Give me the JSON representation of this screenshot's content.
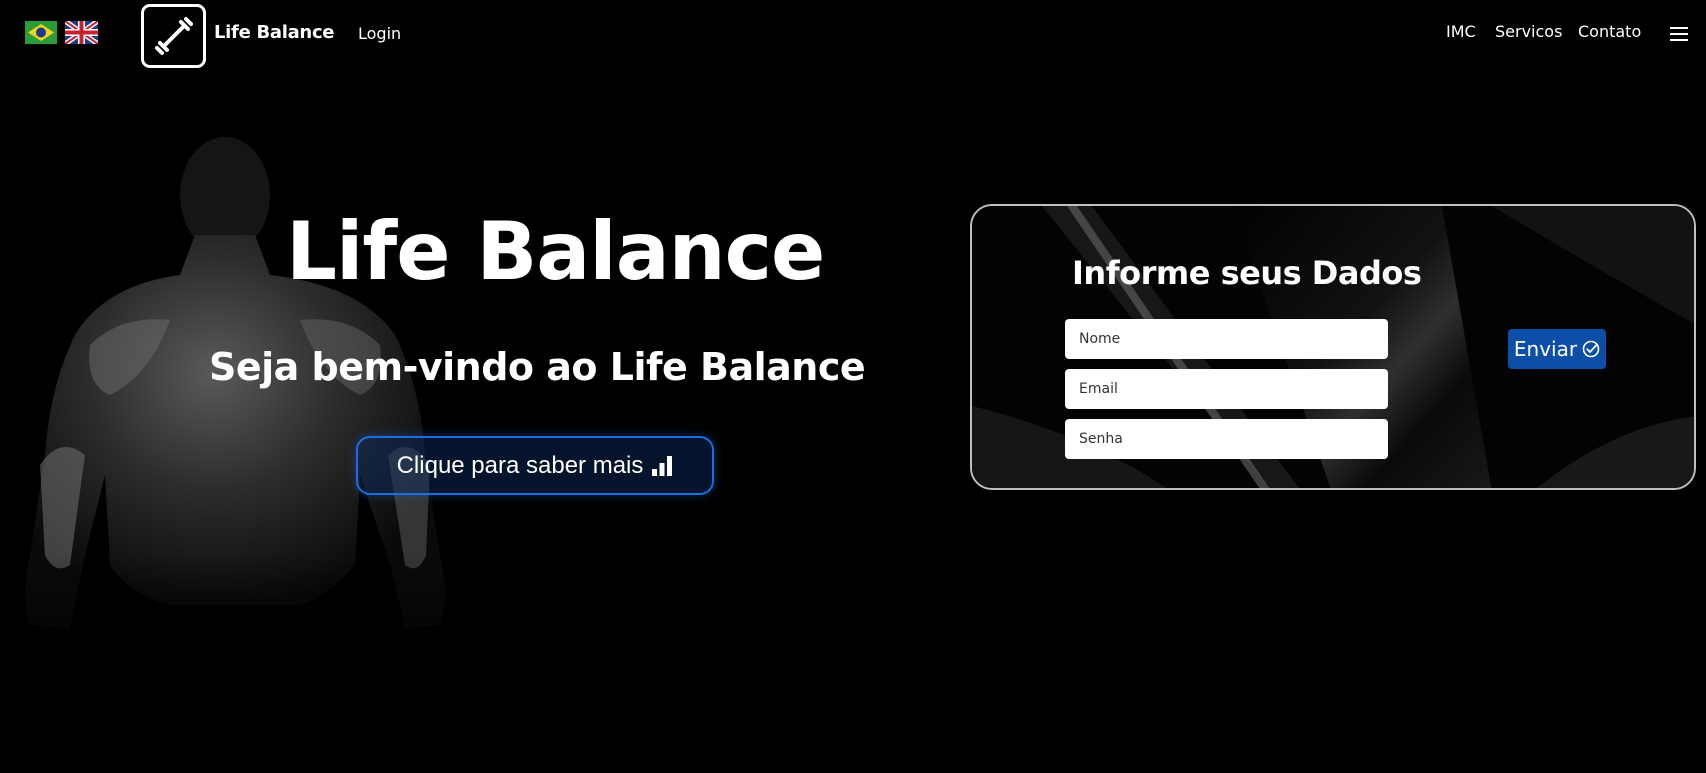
{
  "header": {
    "flags": [
      {
        "name": "brazil-flag-icon",
        "language": "pt-BR"
      },
      {
        "name": "uk-flag-icon",
        "language": "en"
      }
    ],
    "logo_icon": "dumbbell-icon",
    "brand": "Life Balance",
    "login_label": "Login",
    "nav": {
      "imc": "IMC",
      "servicos": "Servicos",
      "contato": "Contato"
    },
    "menu_icon": "hamburger-menu-icon"
  },
  "hero": {
    "title": "Life Balance",
    "subtitle": "Seja bem-vindo ao Life Balance",
    "cta_label": "Clique para saber mais",
    "cta_icon": "bar-chart-icon"
  },
  "form": {
    "title": "Informe seus Dados",
    "fields": {
      "nome": {
        "placeholder": "Nome",
        "value": ""
      },
      "email": {
        "placeholder": "Email",
        "value": ""
      },
      "senha": {
        "placeholder": "Senha",
        "value": ""
      }
    },
    "submit_label": "Enviar",
    "submit_icon": "check-circle-icon"
  },
  "colors": {
    "background": "#000000",
    "accent_blue": "#0d4fa8",
    "cta_border": "#1a6fe0",
    "text": "#ffffff"
  }
}
